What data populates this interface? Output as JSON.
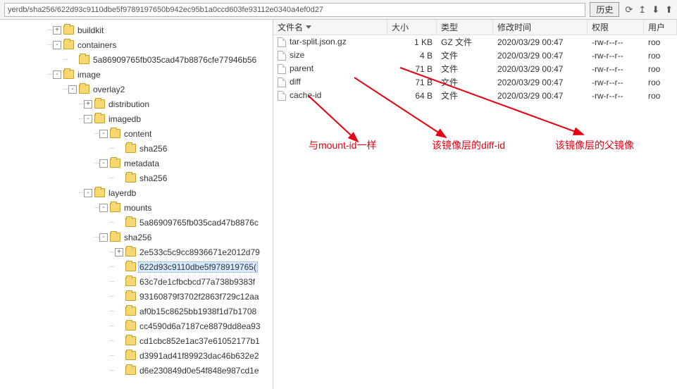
{
  "topbar": {
    "path": "yerdb/sha256/622d93c9110dbe5f9789197650b942ec95b1a0ccd603fe93112e0340a4ef0d27",
    "history_label": "历史",
    "icons": [
      "refresh",
      "up",
      "download",
      "upload"
    ]
  },
  "tree": [
    {
      "indent": 0,
      "toggle": "+",
      "label": "buildkit"
    },
    {
      "indent": 0,
      "toggle": "-",
      "label": "containers"
    },
    {
      "indent": 1,
      "toggle": " ",
      "label": "5a86909765fb035cad47b8876cfe77946b56"
    },
    {
      "indent": 0,
      "toggle": "-",
      "label": "image"
    },
    {
      "indent": 1,
      "toggle": "-",
      "label": "overlay2"
    },
    {
      "indent": 2,
      "toggle": "+",
      "label": "distribution"
    },
    {
      "indent": 2,
      "toggle": "-",
      "label": "imagedb"
    },
    {
      "indent": 3,
      "toggle": "-",
      "label": "content"
    },
    {
      "indent": 4,
      "toggle": " ",
      "label": "sha256"
    },
    {
      "indent": 3,
      "toggle": "-",
      "label": "metadata"
    },
    {
      "indent": 4,
      "toggle": " ",
      "label": "sha256"
    },
    {
      "indent": 2,
      "toggle": "-",
      "label": "layerdb"
    },
    {
      "indent": 3,
      "toggle": "-",
      "label": "mounts"
    },
    {
      "indent": 4,
      "toggle": " ",
      "label": "5a86909765fb035cad47b8876c"
    },
    {
      "indent": 3,
      "toggle": "-",
      "label": "sha256"
    },
    {
      "indent": 4,
      "toggle": "+",
      "label": "2e533c5c9cc8936671e2012d79"
    },
    {
      "indent": 4,
      "toggle": " ",
      "label": "622d93c9110dbe5f978919765(",
      "selected": true
    },
    {
      "indent": 4,
      "toggle": " ",
      "label": "63c7de1cfbcbcd77a738b9383f"
    },
    {
      "indent": 4,
      "toggle": " ",
      "label": "93160879f3702f2863f729c12aa"
    },
    {
      "indent": 4,
      "toggle": " ",
      "label": "af0b15c8625bb1938f1d7b1708"
    },
    {
      "indent": 4,
      "toggle": " ",
      "label": "cc4590d6a7187ce8879dd8ea93"
    },
    {
      "indent": 4,
      "toggle": " ",
      "label": "cd1cbc852e1ac37e61052177b1"
    },
    {
      "indent": 4,
      "toggle": " ",
      "label": "d3991ad41f89923dac46b632e2"
    },
    {
      "indent": 4,
      "toggle": " ",
      "label": "d6e230849d0e54f848e987cd1e"
    }
  ],
  "columns": {
    "name": "文件名",
    "size": "大小",
    "type": "类型",
    "modified": "修改时间",
    "perm": "权限",
    "user": "用户"
  },
  "files": [
    {
      "name": "tar-split.json.gz",
      "size": "1 KB",
      "type": "GZ 文件",
      "date": "2020/03/29 00:47",
      "perm": "-rw-r--r--",
      "user": "roo"
    },
    {
      "name": "size",
      "size": "4 B",
      "type": "文件",
      "date": "2020/03/29 00:47",
      "perm": "-rw-r--r--",
      "user": "roo"
    },
    {
      "name": "parent",
      "size": "71 B",
      "type": "文件",
      "date": "2020/03/29 00:47",
      "perm": "-rw-r--r--",
      "user": "roo"
    },
    {
      "name": "diff",
      "size": "71 B",
      "type": "文件",
      "date": "2020/03/29 00:47",
      "perm": "-rw-r--r--",
      "user": "roo"
    },
    {
      "name": "cache-id",
      "size": "64 B",
      "type": "文件",
      "date": "2020/03/29 00:47",
      "perm": "-rw-r--r--",
      "user": "roo"
    }
  ],
  "annotations": {
    "a1": "与mount-id一样",
    "a2": "该镜像层的diff-id",
    "a3": "该镜像层的父镜像"
  }
}
